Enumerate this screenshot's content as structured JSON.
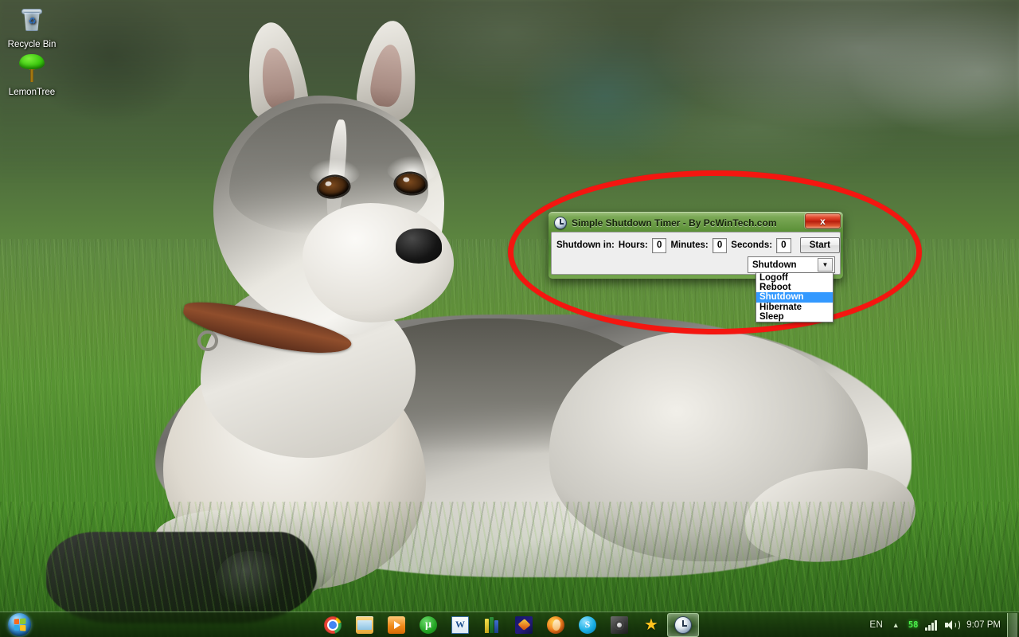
{
  "desktop": {
    "icons": [
      {
        "label": "Recycle Bin",
        "icon": "recycle-bin-icon"
      },
      {
        "label": "LemonTree",
        "icon": "tree-icon"
      }
    ]
  },
  "annotation": {
    "shape": "ellipse",
    "color": "#f41610"
  },
  "app_window": {
    "title": "Simple Shutdown Timer - By PcWinTech.com",
    "title_icon": "clock-icon",
    "close_label": "x",
    "form": {
      "prefix_label": "Shutdown in:",
      "hours_label": "Hours:",
      "hours_value": "0",
      "minutes_label": "Minutes:",
      "minutes_value": "0",
      "seconds_label": "Seconds:",
      "seconds_value": "0",
      "start_label": "Start"
    },
    "combo": {
      "selected": "Shutdown",
      "arrow": "▼",
      "options": [
        {
          "label": "Logoff",
          "selected": false
        },
        {
          "label": "Reboot",
          "selected": false
        },
        {
          "label": "Shutdown",
          "selected": true
        },
        {
          "label": "Hibernate",
          "selected": false
        },
        {
          "label": "Sleep",
          "selected": false
        }
      ],
      "highlight_color": "#3399ff"
    }
  },
  "taskbar": {
    "start_button": "start-orb",
    "pinned": [
      {
        "name": "chrome",
        "cls": "ti-chrome",
        "glyph": ""
      },
      {
        "name": "file-explorer",
        "cls": "ti-explorer",
        "glyph": ""
      },
      {
        "name": "media-player",
        "cls": "ti-media",
        "glyph": ""
      },
      {
        "name": "utorrent",
        "cls": "ti-utorrent",
        "glyph": "µ"
      },
      {
        "name": "word",
        "cls": "ti-word",
        "glyph": "W"
      },
      {
        "name": "books",
        "cls": "ti-books",
        "glyph": ""
      },
      {
        "name": "photo-editor",
        "cls": "ti-photo",
        "glyph": ""
      },
      {
        "name": "ccleaner",
        "cls": "ti-ccleaner",
        "glyph": ""
      },
      {
        "name": "skype",
        "cls": "ti-skype",
        "glyph": "S"
      },
      {
        "name": "disc-burner",
        "cls": "ti-disc",
        "glyph": ""
      },
      {
        "name": "star-app",
        "cls": "ti-star",
        "glyph": "★"
      },
      {
        "name": "shutdown-timer",
        "cls": "ti-timer",
        "glyph": "",
        "active": true
      }
    ],
    "tray": {
      "language": "EN",
      "expand": "▲",
      "memory": "58",
      "clock": "9:07 PM"
    }
  }
}
